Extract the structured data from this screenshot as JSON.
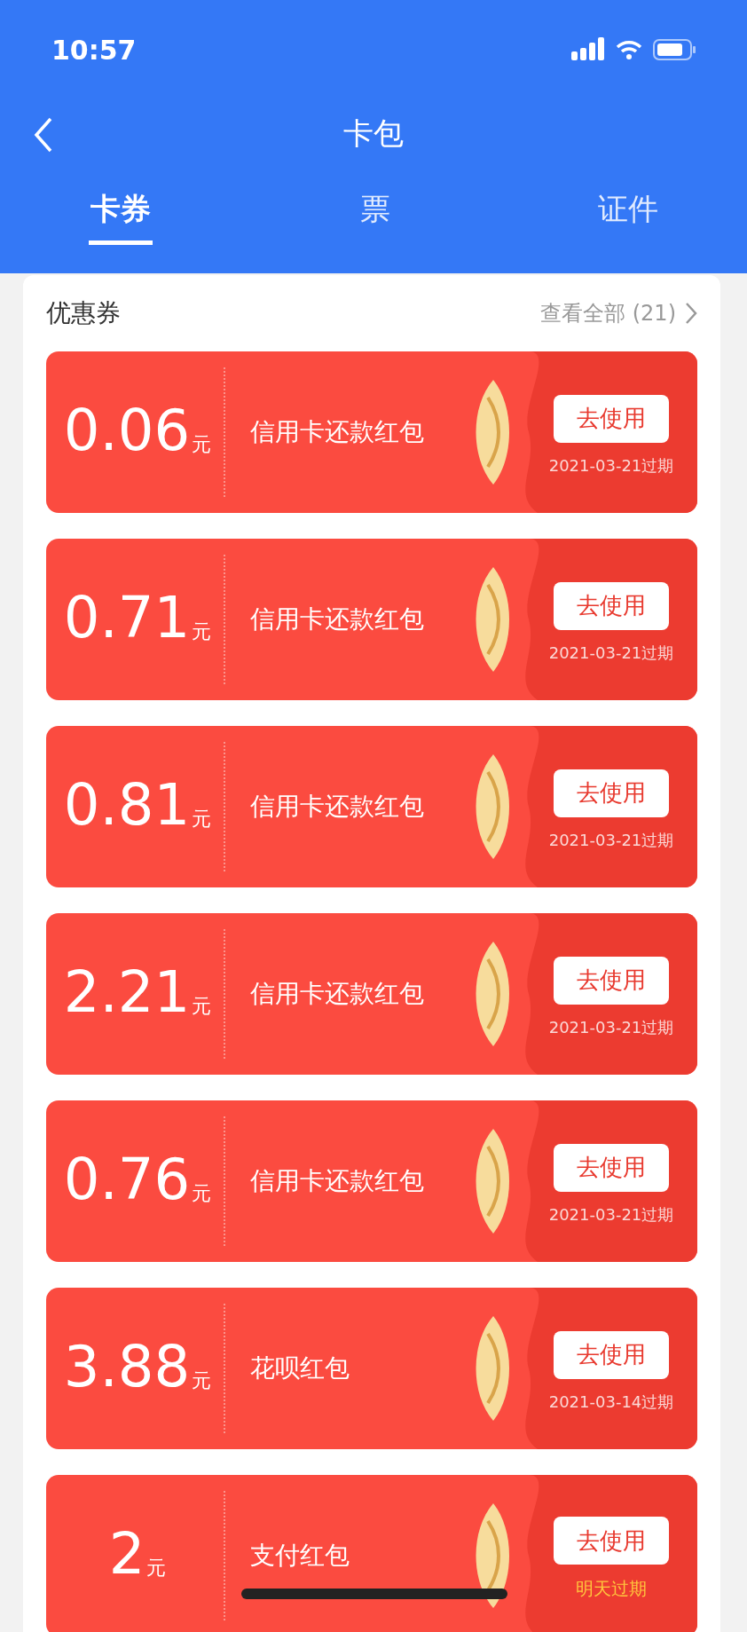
{
  "status_bar": {
    "time": "10:57"
  },
  "nav": {
    "title": "卡包"
  },
  "tabs": [
    {
      "label": "卡券",
      "selected": true
    },
    {
      "label": "票",
      "selected": false
    },
    {
      "label": "证件",
      "selected": false
    }
  ],
  "section": {
    "title": "优惠券",
    "view_all": "查看全部 (21)"
  },
  "coupons": [
    {
      "amount": "0.06",
      "unit": "元",
      "name": "信用卡还款红包",
      "action": "去使用",
      "expiry": "2021-03-21过期",
      "urgent": false
    },
    {
      "amount": "0.71",
      "unit": "元",
      "name": "信用卡还款红包",
      "action": "去使用",
      "expiry": "2021-03-21过期",
      "urgent": false
    },
    {
      "amount": "0.81",
      "unit": "元",
      "name": "信用卡还款红包",
      "action": "去使用",
      "expiry": "2021-03-21过期",
      "urgent": false
    },
    {
      "amount": "2.21",
      "unit": "元",
      "name": "信用卡还款红包",
      "action": "去使用",
      "expiry": "2021-03-21过期",
      "urgent": false
    },
    {
      "amount": "0.76",
      "unit": "元",
      "name": "信用卡还款红包",
      "action": "去使用",
      "expiry": "2021-03-21过期",
      "urgent": false
    },
    {
      "amount": "3.88",
      "unit": "元",
      "name": "花呗红包",
      "action": "去使用",
      "expiry": "2021-03-14过期",
      "urgent": false
    },
    {
      "amount": "2",
      "unit": "元",
      "name": "支付红包",
      "action": "去使用",
      "expiry": "明天过期",
      "urgent": true
    }
  ]
}
